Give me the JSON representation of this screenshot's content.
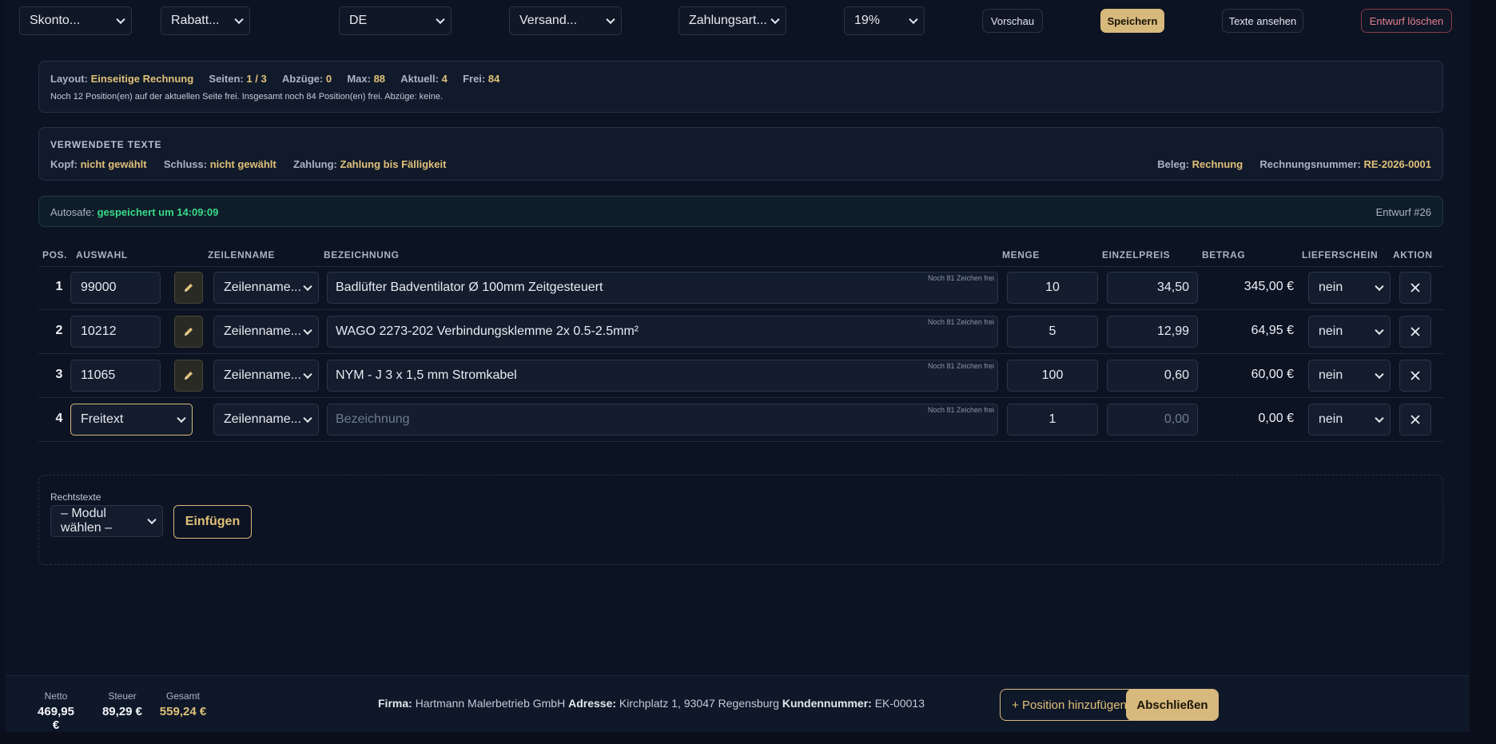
{
  "toolbar": {
    "selects": [
      {
        "value": "Skonto..."
      },
      {
        "value": "Rabatt..."
      },
      {
        "value": "DE"
      },
      {
        "value": "Versand..."
      },
      {
        "value": "Zahlungsart..."
      },
      {
        "value": "19%"
      }
    ],
    "preview_label": "Vorschau",
    "save_label": "Speichern",
    "texts_label": "Texte ansehen",
    "delete_label": "Entwurf löschen"
  },
  "layout_info": {
    "layout_label": "Layout:",
    "layout_value": "Einseitige Rechnung",
    "pages_label": "Seiten:",
    "pages_value": "1 / 3",
    "deductions_label": "Abzüge:",
    "deductions_value": "0",
    "max_label": "Max:",
    "max_value": "88",
    "current_label": "Aktuell:",
    "current_value": "4",
    "free_label": "Frei:",
    "free_value": "84",
    "note": "Noch 12 Position(en) auf der aktuellen Seite frei. Insgesamt noch 84 Position(en) frei. Abzüge: keine."
  },
  "texts_info": {
    "heading": "VERWENDETE TEXTE",
    "head_label": "Kopf:",
    "head_value": "nicht gewählt",
    "closing_label": "Schluss:",
    "closing_value": "nicht gewählt",
    "payment_label": "Zahlung:",
    "payment_value": "Zahlung bis Fälligkeit",
    "doc_label": "Beleg:",
    "doc_value": "Rechnung",
    "invoice_label": "Rechnungsnummer:",
    "invoice_value": "RE-2026-0001"
  },
  "autosave": {
    "label": "Autosafe:",
    "value": "gespeichert um 14:09:09",
    "draft": "Entwurf #26"
  },
  "table": {
    "headers": [
      "POS.",
      "AUSWAHL",
      "ZEILENNAME",
      "BEZEICHNUNG",
      "MENGE",
      "EINZELPREIS",
      "BETRAG",
      "LIEFERSCHEIN",
      "AKTION"
    ],
    "rows": [
      {
        "pos": "1",
        "select": "99000",
        "rowname": "Zeilenname...",
        "desc": "Badlüfter Badventilator Ø 100mm Zeitgesteuert",
        "hint": "Noch 81 Zeichen frei",
        "qty": "10",
        "price": "34,50",
        "amount": "345,00 €",
        "delivery": "nein"
      },
      {
        "pos": "2",
        "select": "10212",
        "rowname": "Zeilenname...",
        "desc": "WAGO 2273-202 Verbindungsklemme 2x 0.5-2.5mm²",
        "hint": "Noch 81 Zeichen frei",
        "qty": "5",
        "price": "12,99",
        "amount": "64,95 €",
        "delivery": "nein"
      },
      {
        "pos": "3",
        "select": "11065",
        "rowname": "Zeilenname...",
        "desc": "NYM - J 3 x 1,5 mm Stromkabel",
        "hint": "Noch 81 Zeichen frei",
        "qty": "100",
        "price": "0,60",
        "amount": "60,00 €",
        "delivery": "nein"
      },
      {
        "pos": "4",
        "select": "Freitext",
        "rowname": "Zeilenname...",
        "desc_placeholder": "Bezeichnung",
        "hint": "Noch 81 Zeichen frei",
        "qty": "1",
        "price_placeholder": "0,00",
        "amount": "0,00 €",
        "delivery": "nein"
      }
    ]
  },
  "legal": {
    "label": "Rechtstexte",
    "select_value": "– Modul wählen –",
    "insert_label": "Einfügen"
  },
  "footer": {
    "net_label": "Netto",
    "net_value": "469,95 €",
    "tax_label": "Steuer",
    "tax_value": "89,29 €",
    "total_label": "Gesamt",
    "total_value": "559,24 €",
    "company_label": "Firma:",
    "company_value": "Hartmann Malerbetrieb GmbH",
    "address_label": "Adresse:",
    "address_value": "Kirchplatz 1, 93047 Regensburg",
    "customer_label": "Kundennummer:",
    "customer_value": "EK-00013",
    "add_label": "+ Position hinzufügen",
    "finish_label": "Abschließen"
  },
  "colors": {
    "accent_gold": "#d7b97d",
    "autosave_green": "#39d98a",
    "danger": "#e2808e",
    "background": "#0c1322"
  }
}
